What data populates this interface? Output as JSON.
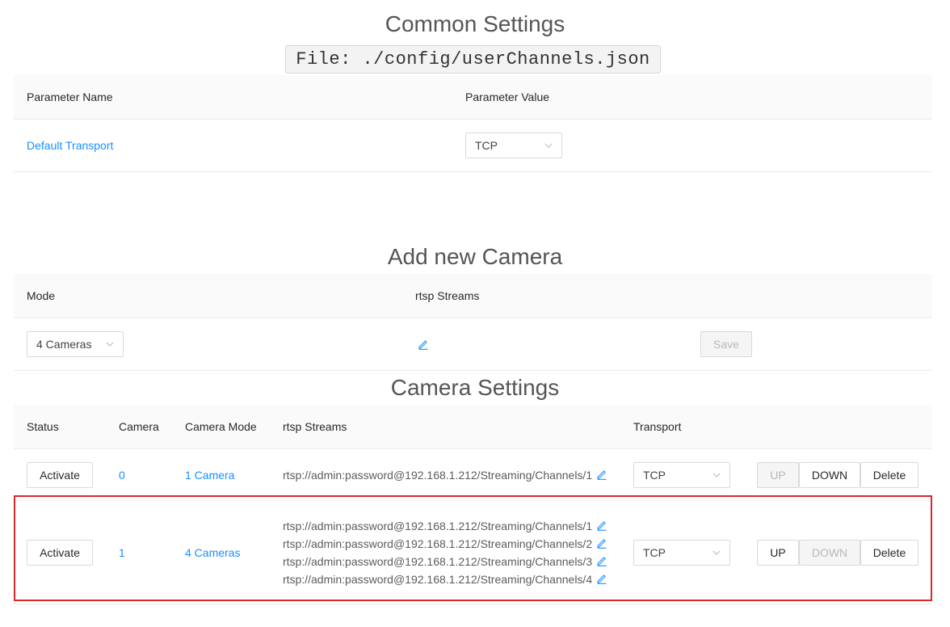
{
  "common": {
    "title": "Common Settings",
    "file_label": "File: ./config/userChannels.json",
    "headers": {
      "param_name": "Parameter Name",
      "param_value": "Parameter Value"
    },
    "rows": [
      {
        "name": "Default Transport",
        "value": "TCP"
      }
    ]
  },
  "add_camera": {
    "title": "Add new Camera",
    "headers": {
      "mode": "Mode",
      "streams": "rtsp Streams"
    },
    "mode_value": "4 Cameras",
    "save_label": "Save"
  },
  "camera_settings": {
    "title": "Camera Settings",
    "headers": {
      "status": "Status",
      "camera": "Camera",
      "camera_mode": "Camera Mode",
      "streams": "rtsp Streams",
      "transport": "Transport"
    },
    "rows": [
      {
        "activate_label": "Activate",
        "camera": "0",
        "mode": "1 Camera",
        "streams": [
          "rtsp://admin:password@192.168.1.212/Streaming/Channels/1"
        ],
        "transport": "TCP",
        "up_label": "UP",
        "down_label": "DOWN",
        "delete_label": "Delete",
        "up_disabled": true,
        "down_disabled": false
      },
      {
        "activate_label": "Activate",
        "camera": "1",
        "mode": "4 Cameras",
        "streams": [
          "rtsp://admin:password@192.168.1.212/Streaming/Channels/1",
          "rtsp://admin:password@192.168.1.212/Streaming/Channels/2",
          "rtsp://admin:password@192.168.1.212/Streaming/Channels/3",
          "rtsp://admin:password@192.168.1.212/Streaming/Channels/4"
        ],
        "transport": "TCP",
        "up_label": "UP",
        "down_label": "DOWN",
        "delete_label": "Delete",
        "up_disabled": false,
        "down_disabled": true
      }
    ]
  },
  "colors": {
    "link": "#1890ff",
    "highlight_border": "#d9272e",
    "header_bg": "#fafafa"
  },
  "icons": {
    "edit": "pencil-edit-icon",
    "select_arrow": "chevron-down-icon"
  }
}
